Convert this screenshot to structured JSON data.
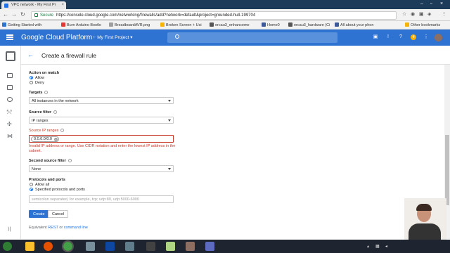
{
  "browser": {
    "tab_title": "VPC network - My First Pr",
    "tab_close": "×",
    "url_secure_label": "Secure",
    "url": "https://console.cloud.google.com/networking/firewalls/add?network=default&project=grounded-hull-199704",
    "bookmarks": [
      {
        "label": "Getting Started with",
        "color": "#2e72d2"
      },
      {
        "label": "Burn Arduino Bootlo",
        "color": "#e53935"
      },
      {
        "label": "BreadboardAVR.png",
        "color": "#9e9e9e"
      },
      {
        "label": "Broken Screen + Usi",
        "color": "#f4b400"
      },
      {
        "label": "ercau3_enhanceme",
        "color": "#555555"
      },
      {
        "label": "Home0",
        "color": "#3b5998"
      },
      {
        "label": "ercau3_hardware (Ci",
        "color": "#555555"
      },
      {
        "label": "All about your phon",
        "color": "#3b5998"
      },
      {
        "label": "Other bookmarks",
        "color": "#f4b400"
      }
    ]
  },
  "header": {
    "title": "Google Cloud Platform",
    "project": "My First Project",
    "notification_count": "4"
  },
  "page": {
    "back": "←",
    "title": "Create a firewall rule"
  },
  "form": {
    "action_on_match_label": "Action on match",
    "action_options": [
      "Allow",
      "Deny"
    ],
    "targets_label": "Targets",
    "targets_value": "All instances in the network",
    "source_filter_label": "Source filter",
    "source_filter_value": "IP ranges",
    "source_ip_ranges_label": "Source IP ranges",
    "source_ip_chip": "0.0.0.0/0.0",
    "source_ip_error": "Invalid IP address or range. Use CIDR notation and enter the lowest IP address in the subnet.",
    "second_source_filter_label": "Second source filter",
    "second_source_filter_value": "None",
    "protocols_label": "Protocols and ports",
    "protocol_options": [
      "Allow all",
      "Specified protocols and ports"
    ],
    "protocols_placeholder": "semicolon separated, for example, tcp; udp:80, udp:5000-6000",
    "create_label": "Create",
    "cancel_label": "Cancel",
    "equivalent_label": "Equivalent",
    "rest_link": "REST",
    "or_label": "or",
    "cli_link": "command line"
  },
  "colors": {
    "brand_blue": "#2e72d2",
    "error_red": "#c53929",
    "link_blue": "#1a73e8"
  },
  "rail": {
    "collapse_icon": "⟩|"
  }
}
